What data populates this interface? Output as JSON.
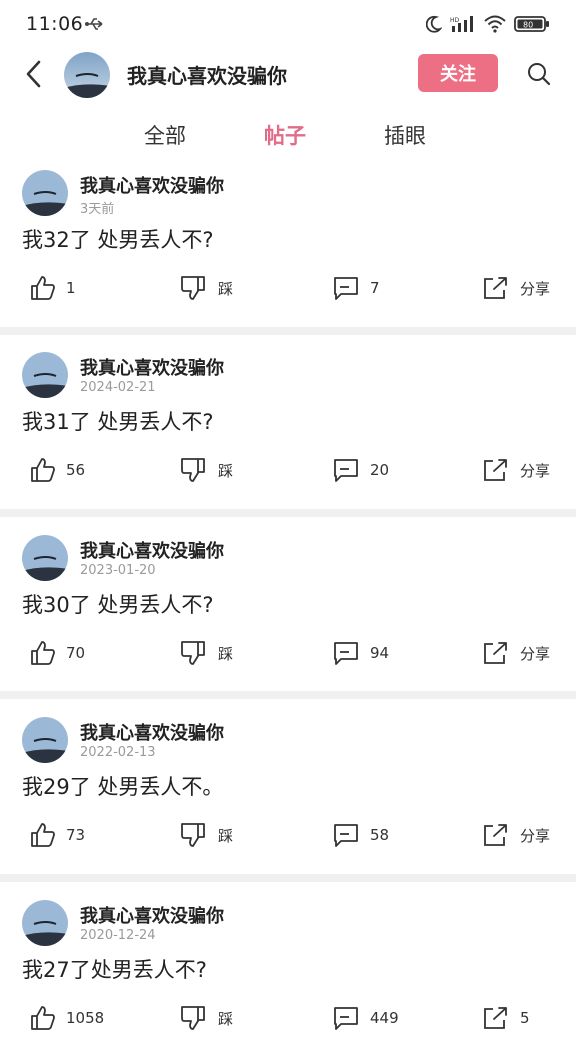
{
  "status_bar": {
    "time": "11:06",
    "battery": "80"
  },
  "header": {
    "title": "我真心喜欢没骗你",
    "follow_label": "关注"
  },
  "tabs": [
    {
      "label": "全部",
      "active": false
    },
    {
      "label": "帖子",
      "active": true
    },
    {
      "label": "插眼",
      "active": false
    }
  ],
  "posts": [
    {
      "author": "我真心喜欢没骗你",
      "time": "3天前",
      "text": "我32了 处男丢人不?",
      "likes": "1",
      "dislike_label": "踩",
      "comments": "7",
      "share": "分享"
    },
    {
      "author": "我真心喜欢没骗你",
      "time": "2024-02-21",
      "text": "我31了 处男丢人不?",
      "likes": "56",
      "dislike_label": "踩",
      "comments": "20",
      "share": "分享"
    },
    {
      "author": "我真心喜欢没骗你",
      "time": "2023-01-20",
      "text": "我30了 处男丢人不?",
      "likes": "70",
      "dislike_label": "踩",
      "comments": "94",
      "share": "分享"
    },
    {
      "author": "我真心喜欢没骗你",
      "time": "2022-02-13",
      "text": "我29了 处男丢人不。",
      "likes": "73",
      "dislike_label": "踩",
      "comments": "58",
      "share": "分享"
    },
    {
      "author": "我真心喜欢没骗你",
      "time": "2020-12-24",
      "text": "我27了处男丢人不?",
      "likes": "1058",
      "dislike_label": "踩",
      "comments": "449",
      "share": "5"
    }
  ],
  "colors": {
    "accent": "#ec6f83",
    "active_tab": "#e16c87",
    "divider": "#f0f0f0"
  }
}
